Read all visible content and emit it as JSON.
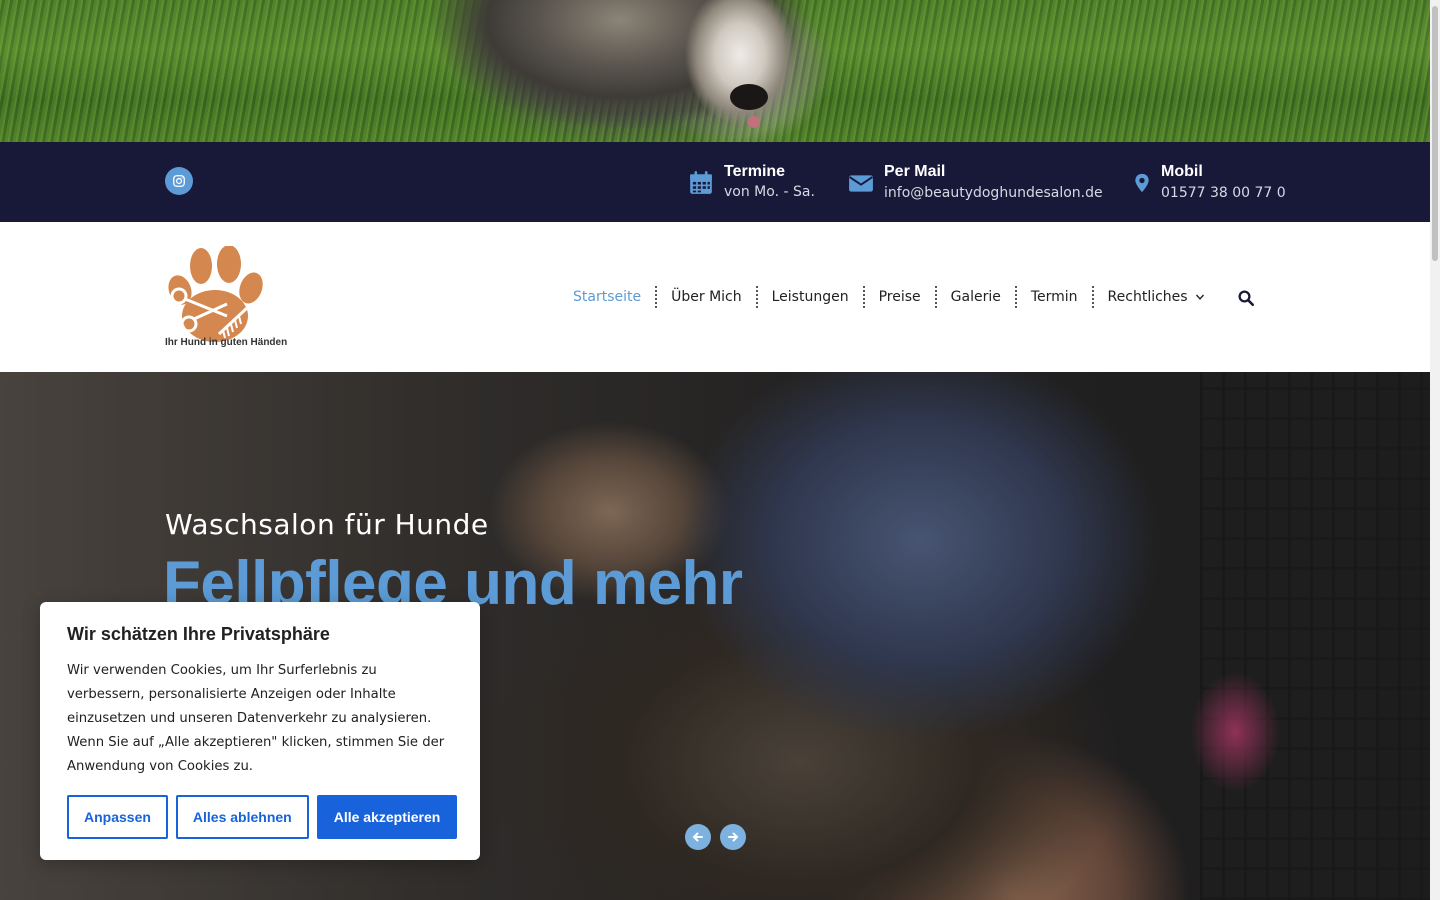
{
  "info_bar": {
    "instagram_icon": "instagram-icon",
    "items": [
      {
        "icon": "calendar-icon",
        "title": "Termine",
        "sub": "von Mo. - Sa."
      },
      {
        "icon": "envelope-icon",
        "title": "Per Mail",
        "sub": "info@beautydoghundesalon.de"
      },
      {
        "icon": "location-pin-icon",
        "title": "Mobil",
        "sub": "01577 38 00 77 0"
      }
    ]
  },
  "logo": {
    "tagline": "Ihr Hund in guten Händen",
    "color": "#d4874f"
  },
  "nav": {
    "items": [
      {
        "label": "Startseite",
        "active": true
      },
      {
        "label": "Über Mich"
      },
      {
        "label": "Leistungen"
      },
      {
        "label": "Preise"
      },
      {
        "label": "Galerie"
      },
      {
        "label": "Termin"
      },
      {
        "label": "Rechtliches",
        "has_dropdown": true
      }
    ],
    "search_icon": "search-icon"
  },
  "hero": {
    "subtitle": "Waschsalon für Hunde",
    "title": "Fellpflege und mehr",
    "prev_icon": "arrow-left-icon",
    "next_icon": "arrow-right-icon"
  },
  "cookie": {
    "title": "Wir schätzen Ihre Privatsphäre",
    "text": "Wir verwenden Cookies, um Ihr Surferlebnis zu verbessern, personalisierte Anzeigen oder Inhalte einzusetzen und unseren Datenverkehr zu analysieren. Wenn Sie auf „Alle akzeptieren\" klicken, stimmen Sie der Anwendung von Cookies zu.",
    "buttons": {
      "customize": "Anpassen",
      "reject": "Alles ablehnen",
      "accept": "Alle akzeptieren"
    }
  },
  "colors": {
    "accent": "#5c9bd6",
    "dark_bar": "#181838",
    "cookie_blue": "#1863dc"
  }
}
